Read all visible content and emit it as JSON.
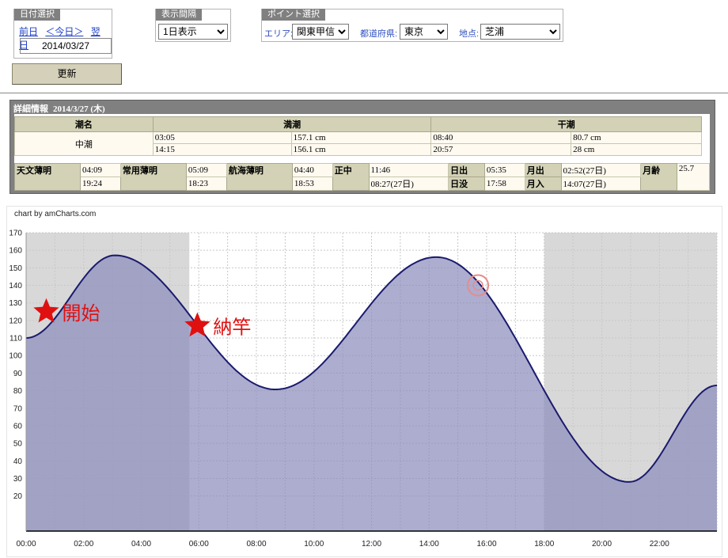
{
  "date_panel": {
    "title": "日付選択",
    "prev": "前日",
    "today": "＜今日＞",
    "next": "翌日",
    "date": "2014/03/27"
  },
  "interval_panel": {
    "title": "表示間隔",
    "selected": "1日表示"
  },
  "point_panel": {
    "title": "ポイント選択",
    "area_label": "エリア:",
    "area": "関東甲信",
    "pref_label": "都道府県:",
    "pref": "東京",
    "place_label": "地点:",
    "place": "芝浦"
  },
  "update_button": "更新",
  "detail": {
    "title": "詳細情報",
    "date": "2014/3/27 (木)",
    "tide_headers": [
      "潮名",
      "満潮",
      "干潮"
    ],
    "tide_name": "中潮",
    "high": [
      {
        "time": "03:05",
        "level": "157.1 cm"
      },
      {
        "time": "14:15",
        "level": "156.1 cm"
      }
    ],
    "low": [
      {
        "time": "08:40",
        "level": "80.7 cm"
      },
      {
        "time": "20:57",
        "level": "28 cm"
      }
    ],
    "astro": {
      "astro_twilight_label": "天文薄明",
      "astro_twilight_start": "04:09",
      "astro_twilight_end": "19:24",
      "civil_twilight_label": "常用薄明",
      "civil_twilight_start": "05:09",
      "civil_twilight_end": "18:23",
      "nautical_twilight_label": "航海薄明",
      "nautical_twilight_start": "04:40",
      "nautical_twilight_end": "18:53",
      "noon_label": "正中",
      "noon_1": "11:46",
      "noon_2": "08:27(27日)",
      "sunrise_label": "日出",
      "sunrise": "05:35",
      "sunset_label": "日没",
      "sunset": "17:58",
      "moonrise_label": "月出",
      "moonrise": "02:52(27日)",
      "moonset_label": "月入",
      "moonset": "14:07(27日)",
      "moon_age_label": "月齢",
      "moon_age": "25.7"
    }
  },
  "chart_credit": "chart by amCharts.com",
  "annotations": {
    "start": "開始",
    "natto": "納竿"
  },
  "colors": {
    "fill": "#8e8ebc",
    "line": "#1a1a6e",
    "night": "#d8d8d8",
    "marker": "#e01010"
  },
  "chart_data": {
    "type": "area",
    "ylim": [
      0,
      170
    ],
    "yticks": [
      20,
      30,
      40,
      50,
      60,
      70,
      80,
      90,
      100,
      110,
      120,
      130,
      140,
      150,
      160,
      170
    ],
    "xticks": [
      "00:00",
      "02:00",
      "04:00",
      "06:00",
      "08:00",
      "10:00",
      "12:00",
      "14:00",
      "16:00",
      "18:00",
      "20:00",
      "22:00"
    ],
    "xlim_hours": [
      0,
      24
    ],
    "night_hours": [
      [
        0,
        5.67
      ],
      [
        18.0,
        24
      ]
    ],
    "extrema": [
      {
        "hour": 0,
        "value": 110
      },
      {
        "hour": 3.083,
        "value": 157.1
      },
      {
        "hour": 8.667,
        "value": 80.7
      },
      {
        "hour": 14.25,
        "value": 156.1
      },
      {
        "hour": 20.95,
        "value": 28
      },
      {
        "hour": 24,
        "value": 83
      }
    ],
    "markers": [
      {
        "hour": 0.7,
        "value": 125,
        "label": "start"
      },
      {
        "hour": 5.95,
        "value": 117,
        "label": "natto"
      },
      {
        "hour": 15.7,
        "value": 140,
        "label": "circle"
      }
    ]
  }
}
